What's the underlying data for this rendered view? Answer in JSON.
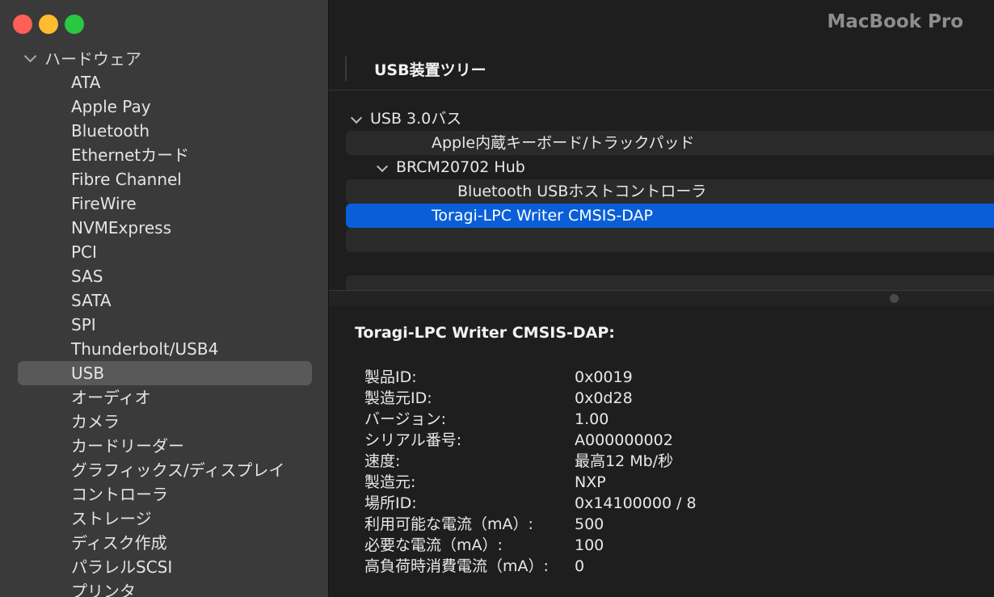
{
  "window": {
    "model": "MacBook Pro"
  },
  "sidebar": {
    "root": "ハードウェア",
    "items": [
      "ATA",
      "Apple Pay",
      "Bluetooth",
      "Ethernetカード",
      "Fibre Channel",
      "FireWire",
      "NVMExpress",
      "PCI",
      "SAS",
      "SATA",
      "SPI",
      "Thunderbolt/USB4",
      "USB",
      "オーディオ",
      "カメラ",
      "カードリーダー",
      "グラフィックス/ディスプレイ",
      "コントローラ",
      "ストレージ",
      "ディスク作成",
      "パラレルSCSI",
      "プリンタ"
    ],
    "selected_index": 12
  },
  "main": {
    "section_title": "USB装置ツリー",
    "tree": [
      {
        "label": "USB 3.0バス",
        "indent": 0,
        "expanded": true
      },
      {
        "label": "Apple内蔵キーボード/トラックパッド",
        "indent": 2
      },
      {
        "label": "BRCM20702 Hub",
        "indent": 1,
        "expanded": true
      },
      {
        "label": "Bluetooth USBホストコントローラ",
        "indent": 3
      },
      {
        "label": "Toragi-LPC Writer CMSIS-DAP",
        "indent": 2,
        "selected": true
      },
      {
        "label": "",
        "indent": 0
      }
    ]
  },
  "detail": {
    "title": "Toragi-LPC Writer CMSIS-DAP:",
    "properties": [
      {
        "key": "製品ID:",
        "value": "0x0019"
      },
      {
        "key": "製造元ID:",
        "value": "0x0d28"
      },
      {
        "key": "バージョン:",
        "value": "1.00"
      },
      {
        "key": "シリアル番号:",
        "value": "A000000002"
      },
      {
        "key": "速度:",
        "value": "最高12 Mb/秒"
      },
      {
        "key": "製造元:",
        "value": "NXP"
      },
      {
        "key": "場所ID:",
        "value": "0x14100000 / 8"
      },
      {
        "key": "利用可能な電流（mA）:",
        "value": "500"
      },
      {
        "key": "必要な電流（mA）:",
        "value": "100"
      },
      {
        "key": "高負荷時消費電流（mA）:",
        "value": "0"
      }
    ]
  }
}
